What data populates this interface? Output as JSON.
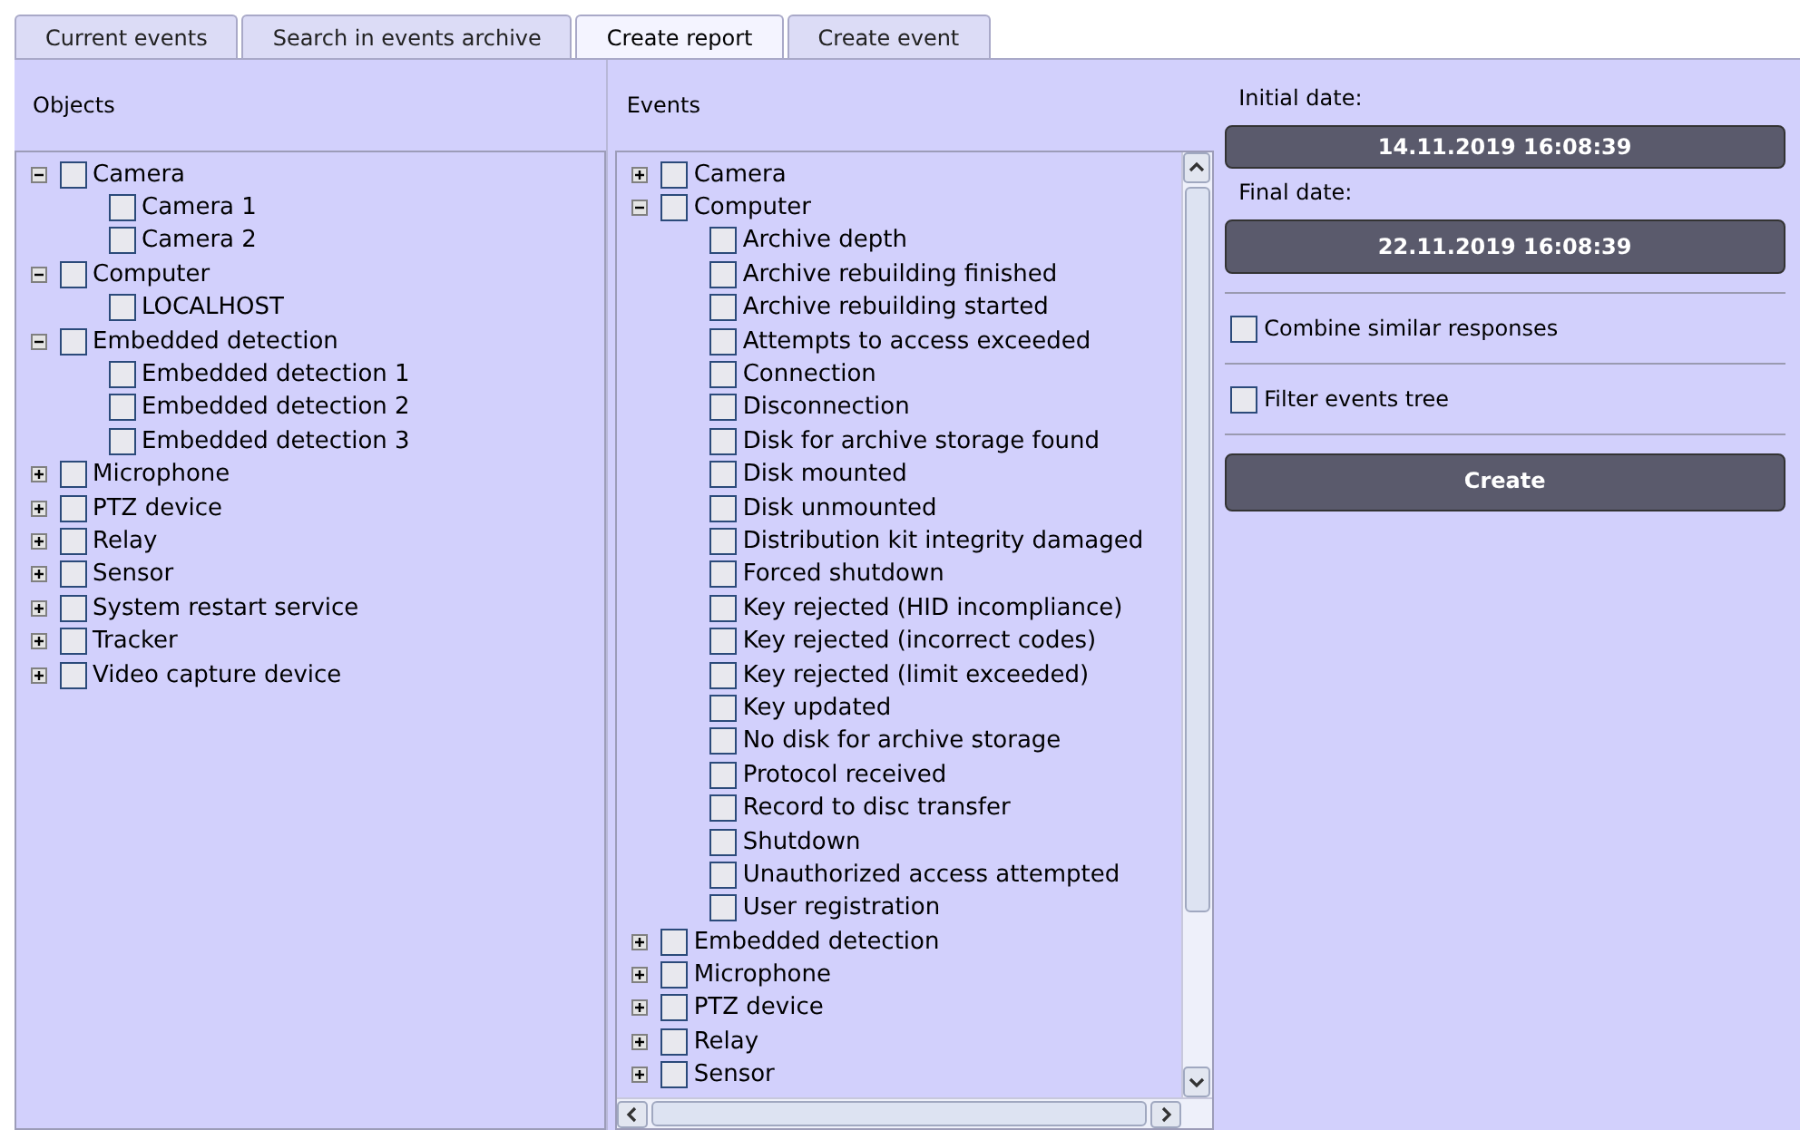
{
  "tabs": [
    {
      "label": "Current events",
      "selected": false
    },
    {
      "label": "Search in events archive",
      "selected": false
    },
    {
      "label": "Create report",
      "selected": true
    },
    {
      "label": "Create event",
      "selected": false
    }
  ],
  "objects": {
    "title": "Objects",
    "items": [
      {
        "label": "Camera",
        "checked": false,
        "expanded": true,
        "children": [
          {
            "label": "Camera 1",
            "checked": false
          },
          {
            "label": "Camera 2",
            "checked": false
          }
        ]
      },
      {
        "label": "Computer",
        "checked": false,
        "expanded": true,
        "children": [
          {
            "label": "LOCALHOST",
            "checked": false
          }
        ]
      },
      {
        "label": "Embedded detection",
        "checked": false,
        "expanded": true,
        "children": [
          {
            "label": "Embedded detection 1",
            "checked": false
          },
          {
            "label": "Embedded detection 2",
            "checked": false
          },
          {
            "label": "Embedded detection 3",
            "checked": false
          }
        ]
      },
      {
        "label": "Microphone",
        "checked": false,
        "expanded": false
      },
      {
        "label": "PTZ device",
        "checked": false,
        "expanded": false
      },
      {
        "label": "Relay",
        "checked": false,
        "expanded": false
      },
      {
        "label": "Sensor",
        "checked": false,
        "expanded": false
      },
      {
        "label": "System restart service",
        "checked": false,
        "expanded": false
      },
      {
        "label": "Tracker",
        "checked": false,
        "expanded": false
      },
      {
        "label": "Video capture device",
        "checked": false,
        "expanded": false
      }
    ]
  },
  "events": {
    "title": "Events",
    "items": [
      {
        "label": "Camera",
        "checked": false,
        "expanded": false
      },
      {
        "label": "Computer",
        "checked": false,
        "expanded": true,
        "children": [
          {
            "label": "Archive depth",
            "checked": false
          },
          {
            "label": "Archive rebuilding finished",
            "checked": false
          },
          {
            "label": "Archive rebuilding started",
            "checked": false
          },
          {
            "label": "Attempts to access exceeded",
            "checked": false
          },
          {
            "label": "Connection",
            "checked": false
          },
          {
            "label": "Disconnection",
            "checked": false
          },
          {
            "label": "Disk for archive storage found",
            "checked": false
          },
          {
            "label": "Disk mounted",
            "checked": false
          },
          {
            "label": "Disk unmounted",
            "checked": false
          },
          {
            "label": "Distribution kit integrity damaged",
            "checked": false
          },
          {
            "label": "Forced shutdown",
            "checked": false
          },
          {
            "label": "Key rejected (HID incompliance)",
            "checked": false
          },
          {
            "label": "Key rejected (incorrect codes)",
            "checked": false
          },
          {
            "label": "Key rejected (limit exceeded)",
            "checked": false
          },
          {
            "label": "Key updated",
            "checked": false
          },
          {
            "label": "No disk for archive storage",
            "checked": false
          },
          {
            "label": "Protocol received",
            "checked": false
          },
          {
            "label": "Record to disc transfer",
            "checked": false
          },
          {
            "label": "Shutdown",
            "checked": false
          },
          {
            "label": "Unauthorized access attempted",
            "checked": false
          },
          {
            "label": "User registration",
            "checked": false
          }
        ]
      },
      {
        "label": "Embedded detection",
        "checked": false,
        "expanded": false
      },
      {
        "label": "Microphone",
        "checked": false,
        "expanded": false
      },
      {
        "label": "PTZ device",
        "checked": false,
        "expanded": false
      },
      {
        "label": "Relay",
        "checked": false,
        "expanded": false
      },
      {
        "label": "Sensor",
        "checked": false,
        "expanded": false
      }
    ]
  },
  "report": {
    "initial_label": "Initial date:",
    "initial_value": "14.11.2019 16:08:39",
    "final_label": "Final date:",
    "final_value": "22.11.2019 16:08:39",
    "options": [
      {
        "label": "Combine similar responses",
        "checked": false
      },
      {
        "label": "Filter events tree",
        "checked": false
      }
    ],
    "create_button": "Create"
  }
}
